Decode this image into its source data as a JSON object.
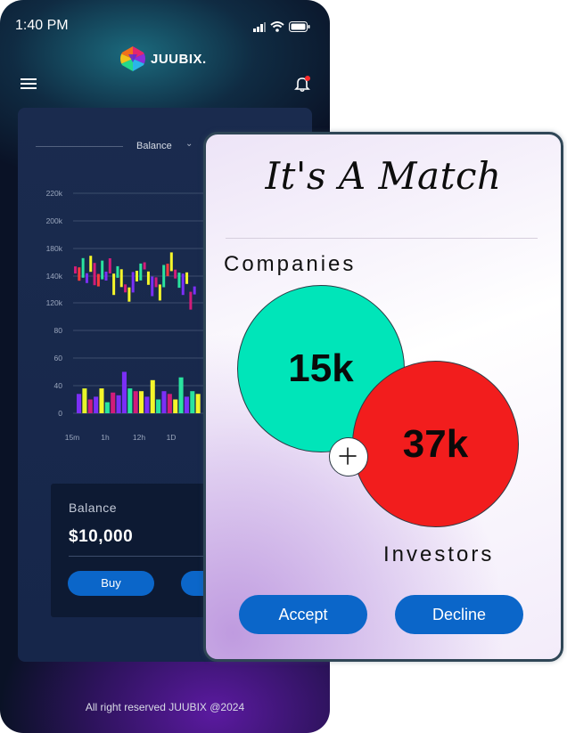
{
  "status_bar": {
    "time": "1:40 PM"
  },
  "header": {
    "brand": "JUUBIX."
  },
  "chart_data": {
    "type": "bar",
    "selector_label": "Balance",
    "y_ticks": [
      "220k",
      "200k",
      "180k",
      "140k",
      "120k",
      "80",
      "60",
      "40",
      "0"
    ],
    "x_ticks": [
      "15m",
      "1h",
      "12h",
      "1D"
    ],
    "volume_values": [
      14,
      18,
      10,
      12,
      18,
      8,
      15,
      13,
      30,
      18,
      16,
      16,
      12,
      24,
      10,
      16,
      14,
      10,
      26,
      12,
      16,
      14
    ],
    "volume_colors": [
      "#7b2ff7",
      "#e7f52a",
      "#d21c7a",
      "#7b2ff7",
      "#f5f62a",
      "#2ae39f",
      "#d21c7a",
      "#7b2ff7",
      "#7b2ff7",
      "#2ae39f",
      "#d21c7a",
      "#f5f62a",
      "#7b2ff7",
      "#f5f62a",
      "#2ae39f",
      "#7b2ff7",
      "#d21c7a",
      "#f5f62a",
      "#2ae39f",
      "#7b2ff7",
      "#2ae39f",
      "#f5f62a"
    ],
    "price_values": [
      143,
      141,
      144,
      139,
      146,
      141,
      138,
      143,
      140,
      145,
      136,
      142,
      139,
      134,
      131,
      137,
      140,
      142,
      145,
      139,
      135,
      137,
      132,
      140,
      143,
      147,
      141,
      138,
      136,
      139,
      128,
      133
    ],
    "price_colors": [
      "#d21c7a",
      "#ff3b3b",
      "#2ae39f",
      "#7b2ff7",
      "#f5f62a",
      "#d21c7a",
      "#ff3b3b",
      "#2ae39f",
      "#7b2ff7",
      "#d21c7a",
      "#f5f62a",
      "#2ae39f",
      "#f5f62a",
      "#d21c7a",
      "#f5f62a",
      "#7b2ff7",
      "#e7f52a",
      "#2ae39f",
      "#d21c7a",
      "#f5f62a",
      "#7b2ff7",
      "#d21c7a",
      "#f5f62a",
      "#2ae39f",
      "#ff3b3b",
      "#f5f62a",
      "#d21c7a",
      "#2ae39f",
      "#7b2ff7",
      "#f5f62a",
      "#d21c7a",
      "#7b2ff7"
    ]
  },
  "balance_card": {
    "title": "Balance",
    "amount": "$10,000",
    "buy_label": "Buy"
  },
  "footer": {
    "text": "All right reserved JUUBIX @2024"
  },
  "match_card": {
    "title": "It's A Match",
    "companies_label": "Companies",
    "companies_value": "15k",
    "investors_label": "Investors",
    "investors_value": "37k",
    "accept_label": "Accept",
    "decline_label": "Decline"
  },
  "colors": {
    "accent": "#0b66c9",
    "companies": "#00e5b9",
    "investors": "#f21d1d"
  }
}
